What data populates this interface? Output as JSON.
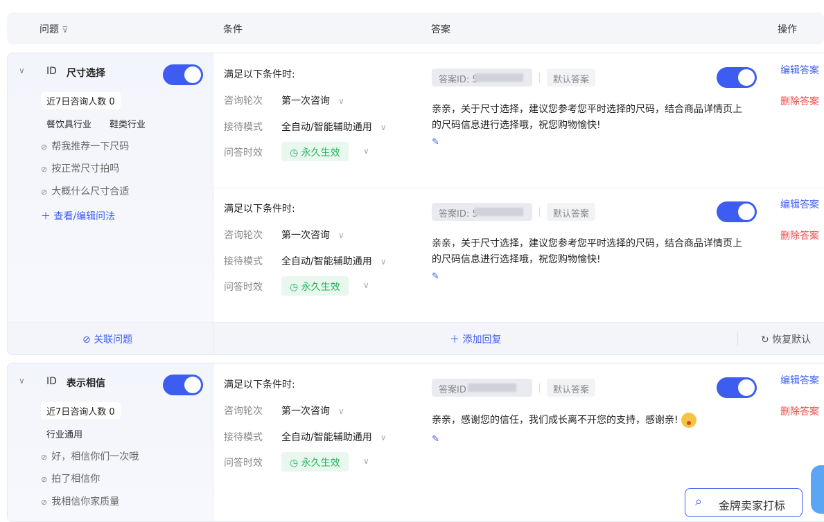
{
  "header": {
    "col_question": "问题",
    "col_condition": "条件",
    "col_answer": "答案",
    "col_action": "操作"
  },
  "cards": [
    {
      "id_label": "ID",
      "title": "尺寸选择",
      "consult_count": "近7日咨询人数 0",
      "industries": [
        "餐饮具行业",
        "鞋类行业"
      ],
      "questions": [
        "帮我推荐一下尺码",
        "按正常尺寸拍吗",
        "大概什么尺寸合适"
      ],
      "view_edit": "查看/编辑问法",
      "link_question": "关联问题",
      "add_reply": "添加回复",
      "restore_default": "恢复默认",
      "rows": [
        {
          "cond_title": "满足以下条件时:",
          "round_label": "咨询轮次",
          "round_value": "第一次咨询",
          "mode_label": "接待模式",
          "mode_value": "全自动/智能辅助通用",
          "eff_label": "问答时效",
          "eff_value": "永久生效",
          "answer_id": "答案ID: 5",
          "default_tag": "默认答案",
          "answer_text": "亲亲，关于尺寸选择，建议您参考您平时选择的尺码，结合商品详情页上的尺码信息进行选择哦，祝您购物愉快!",
          "edit": "编辑答案",
          "delete": "删除答案"
        },
        {
          "cond_title": "满足以下条件时:",
          "round_label": "咨询轮次",
          "round_value": "第一次咨询",
          "mode_label": "接待模式",
          "mode_value": "全自动/智能辅助通用",
          "eff_label": "问答时效",
          "eff_value": "永久生效",
          "answer_id": "答案ID: 5",
          "default_tag": "默认答案",
          "answer_text": "亲亲，关于尺寸选择，建议您参考您平时选择的尺码，结合商品详情页上的尺码信息进行选择哦，祝您购物愉快!",
          "edit": "编辑答案",
          "delete": "删除答案"
        }
      ]
    },
    {
      "id_label": "ID",
      "title": "表示相信",
      "consult_count": "近7日咨询人数 0",
      "industries": [
        "行业通用"
      ],
      "questions": [
        "好，相信你们一次哦",
        "拍了相信你",
        "我相信你家质量"
      ],
      "rows": [
        {
          "cond_title": "满足以下条件时:",
          "round_label": "咨询轮次",
          "round_value": "第一次咨询",
          "mode_label": "接待模式",
          "mode_value": "全自动/智能辅助通用",
          "eff_label": "问答时效",
          "eff_value": "永久生效",
          "answer_id": "答案ID",
          "default_tag": "默认答案",
          "answer_text": "亲亲，感谢您的信任，我们成长离不开您的支持，感谢亲!",
          "edit": "编辑答案",
          "delete": "删除答案"
        }
      ]
    }
  ],
  "search": {
    "label": "金牌卖家打标"
  },
  "colors": {
    "accent": "#3d5df2",
    "success": "#27b15a",
    "danger": "#f04848"
  }
}
